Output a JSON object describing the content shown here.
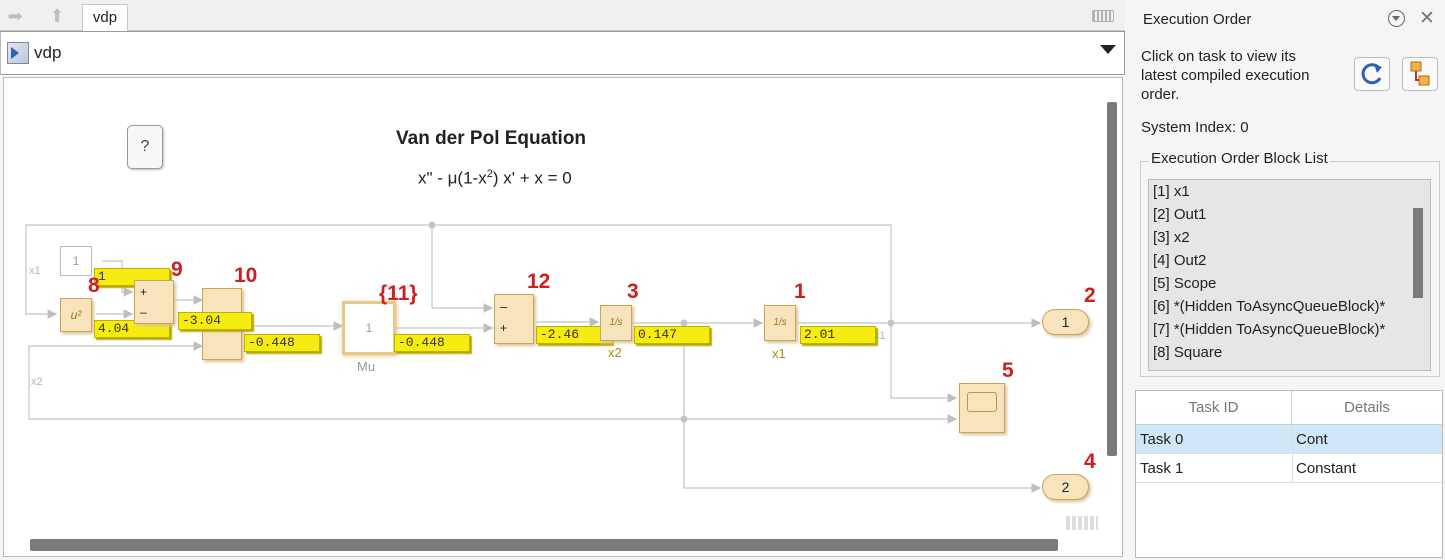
{
  "tabs": {
    "active_label": "vdp"
  },
  "address_bar": {
    "path": "vdp"
  },
  "diagram": {
    "title": "Van der Pol Equation",
    "equation_pre": "x\" - μ(1-x",
    "equation_sup": "2",
    "equation_post": ") x' + x = 0",
    "help_label": "?",
    "signal_labels": {
      "x1_left": "x1",
      "x2_left": "x2",
      "x1_right": "x1"
    },
    "blocks": {
      "const_top": "1",
      "square": "u²",
      "sum9_plus": "+",
      "sum9_minus": "–",
      "mu_value": "1",
      "mu_label": "Mu",
      "sum12_minus": "–",
      "sum12_plus": "+",
      "int_x2": "1/s",
      "int_x2_label": "x2",
      "int_x1": "1/s",
      "int_x1_label": "x1",
      "out1": "1",
      "out2": "2"
    },
    "displays": {
      "d_const": "1",
      "d_square": "4.04",
      "d_prod_a": "-3.04",
      "d_prod_b": "-0.448",
      "d_mu": "-0.448",
      "d_sum12": "-2.46",
      "d_x2": "0.147",
      "d_x1": "2.01"
    },
    "order_numbers": {
      "n8": "8",
      "n9": "9",
      "n10": "10",
      "n11": "{11}",
      "n12": "12",
      "n3": "3",
      "n1": "1",
      "n2": "2",
      "n5": "5",
      "n4": "4"
    }
  },
  "panel": {
    "title": "Execution Order",
    "description": "Click on task to view its latest compiled execution order.",
    "system_index": "System Index: 0",
    "block_list_legend": "Execution Order Block List",
    "block_list": [
      "[1]  x1",
      "[2]  Out1",
      "[3]  x2",
      "[4]  Out2",
      "[5]  Scope",
      "[6]  *(Hidden ToAsyncQueueBlock)*",
      "[7]  *(Hidden ToAsyncQueueBlock)*",
      "[8]  Square"
    ],
    "task_table": {
      "headers": [
        "Task ID",
        "Details"
      ],
      "rows": [
        {
          "id": "Task 0",
          "details": "Cont"
        },
        {
          "id": "Task 1",
          "details": "Constant"
        }
      ]
    }
  }
}
